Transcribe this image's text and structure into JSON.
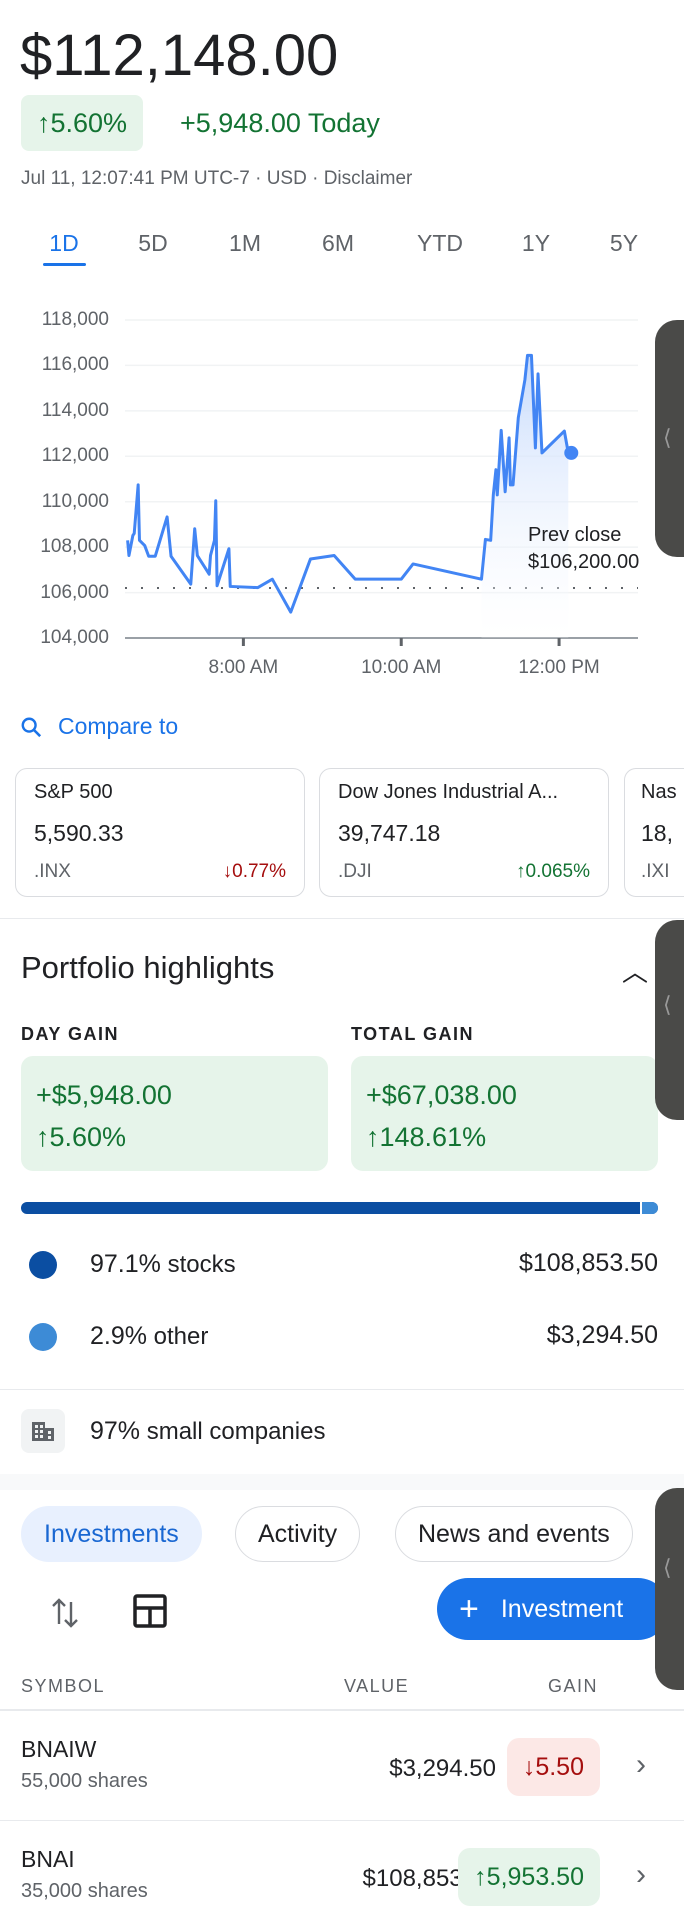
{
  "header": {
    "price": "$112,148.00",
    "change_pct": "5.60%",
    "change_today": "+5,948.00 Today",
    "meta": "Jul 11, 12:07:41 PM UTC-7 · USD · Disclaimer"
  },
  "ranges": [
    "1D",
    "5D",
    "1M",
    "6M",
    "YTD",
    "1Y",
    "5Y"
  ],
  "active_range": "1D",
  "chart_data": {
    "type": "line",
    "ylim": [
      104000,
      118000
    ],
    "yticks": [
      "118,000",
      "116,000",
      "114,000",
      "112,000",
      "110,000",
      "108,000",
      "106,000",
      "104,000"
    ],
    "xlim": [
      "6:30",
      "13:00"
    ],
    "xticks": [
      {
        "t": "8:00",
        "label": "8:00 AM"
      },
      {
        "t": "10:00",
        "label": "10:00 AM"
      },
      {
        "t": "12:00",
        "label": "12:00 PM"
      }
    ],
    "grid": true,
    "line_color": "#4285f4",
    "prev_close": 106200,
    "prev_close_label": "Prev close",
    "prev_close_value": "$106,200.00",
    "x": [
      "6:32",
      "6:33",
      "6:36",
      "6:37",
      "6:40",
      "6:41",
      "6:45",
      "6:48",
      "6:53",
      "7:02",
      "7:05",
      "7:20",
      "7:23",
      "7:25",
      "7:34",
      "7:35",
      "7:38",
      "7:39",
      "7:40",
      "7:49",
      "7:50",
      "8:11",
      "8:22",
      "8:36",
      "8:51",
      "9:09",
      "9:25",
      "10:00",
      "10:09",
      "11:01",
      "11:04",
      "11:08",
      "11:10",
      "11:12",
      "11:13",
      "11:16",
      "11:19",
      "11:22",
      "11:23",
      "11:25",
      "11:29",
      "11:34",
      "11:36",
      "11:39",
      "11:42",
      "11:44",
      "11:47",
      "12:04",
      "12:07"
    ],
    "y": [
      108300,
      107630,
      108520,
      108600,
      110740,
      108300,
      108070,
      107600,
      107600,
      109330,
      107600,
      106370,
      108810,
      107630,
      106810,
      107630,
      108300,
      110040,
      106300,
      107930,
      106270,
      106220,
      106590,
      105140,
      107480,
      107630,
      106590,
      106590,
      107260,
      106590,
      108340,
      108300,
      110300,
      111410,
      110300,
      113140,
      110440,
      112810,
      110740,
      110740,
      113700,
      115360,
      116440,
      116440,
      112370,
      115630,
      112150,
      113110,
      112148
    ]
  },
  "compare": {
    "label": "Compare to",
    "cards": [
      {
        "name": "S&P 500",
        "value": "5,590.33",
        "ticker": ".INX",
        "change": "0.77%",
        "dir": "down"
      },
      {
        "name": "Dow Jones Industrial A...",
        "value": "39,747.18",
        "ticker": ".DJI",
        "change": "0.065%",
        "dir": "up"
      },
      {
        "name": "Nas",
        "value": "18,",
        "ticker": ".IXI",
        "change": "",
        "dir": "up"
      }
    ]
  },
  "portfolio": {
    "title": "Portfolio highlights",
    "day_gain_label": "DAY GAIN",
    "day_gain": "+$5,948.00",
    "day_gain_pct": "5.60%",
    "total_gain_label": "TOTAL GAIN",
    "total_gain": "+$67,038.00",
    "total_gain_pct": "148.61%",
    "allocation": [
      {
        "pct": "97.1%",
        "name": "stocks",
        "value": "$108,853.50",
        "color": "#0b4ea2",
        "share": 97.1
      },
      {
        "pct": "2.9%",
        "name": "other",
        "value": "$3,294.50",
        "color": "#3d8bd6",
        "share": 2.9
      }
    ],
    "size_pct": "97%",
    "size_label": "small companies"
  },
  "tabs": [
    "Investments",
    "Activity",
    "News and events"
  ],
  "add_button": "Investment",
  "table": {
    "headers": [
      "SYMBOL",
      "VALUE",
      "GAIN"
    ],
    "rows": [
      {
        "symbol": "BNAIW",
        "shares": "55,000 shares",
        "value": "$3,294.50",
        "gain": "5.50",
        "dir": "down"
      },
      {
        "symbol": "BNAI",
        "shares": "35,000 shares",
        "value": "$108,853.50",
        "gain": "5,953.50",
        "dir": "up"
      }
    ]
  }
}
